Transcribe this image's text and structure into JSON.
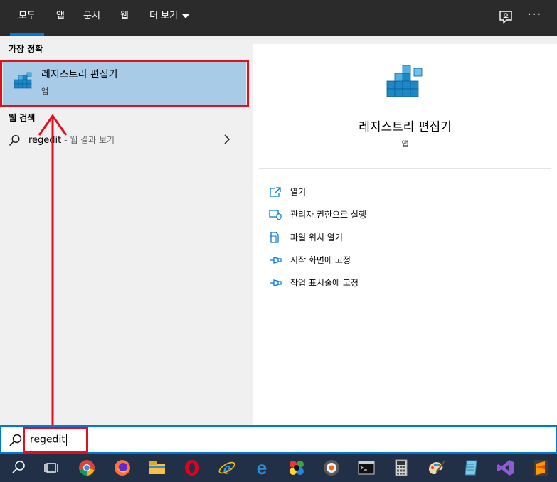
{
  "tabs": [
    {
      "label": "모두",
      "active": true
    },
    {
      "label": "앱",
      "active": false
    },
    {
      "label": "문서",
      "active": false
    },
    {
      "label": "웹",
      "active": false
    },
    {
      "label": "더 보기",
      "active": false
    }
  ],
  "top_icons": [
    "feedback-icon",
    "more-options-icon"
  ],
  "more_glyph": "···",
  "left": {
    "best_match_title": "가장 정확",
    "best_match": {
      "name": "레지스트리 편집기",
      "type": "앱",
      "icon": "registry-editor-icon"
    },
    "web_search_title": "웹 검색",
    "web_result": {
      "query": "regedit",
      "suffix": " - 웹 결과 보기"
    }
  },
  "right": {
    "app_name": "레지스트리 편집기",
    "app_type": "앱",
    "actions": [
      {
        "label": "열기",
        "icon": "open-icon"
      },
      {
        "label": "관리자 권한으로 실행",
        "icon": "shield-icon"
      },
      {
        "label": "파일 위치 열기",
        "icon": "file-location-icon"
      },
      {
        "label": "시작 화면에 고정",
        "icon": "pin-icon"
      },
      {
        "label": "작업 표시줄에 고정",
        "icon": "pin-icon"
      }
    ]
  },
  "search": {
    "value": "regedit"
  },
  "taskbar": [
    "search-icon",
    "task-view-icon",
    "chrome-icon",
    "firefox-icon",
    "file-explorer-icon",
    "opera-icon",
    "internet-explorer-icon",
    "edge-icon",
    "paint-app-icon",
    "media-player-icon",
    "command-prompt-icon",
    "calculator-icon",
    "paint-icon",
    "notepad-icon",
    "visual-studio-icon",
    "sublime-text-icon"
  ],
  "colors": {
    "accent": "#0078d7",
    "selection": "#a8cbe8",
    "annotation": "#e01020",
    "taskbar": "#213047",
    "topbar": "#2b2b2b"
  }
}
